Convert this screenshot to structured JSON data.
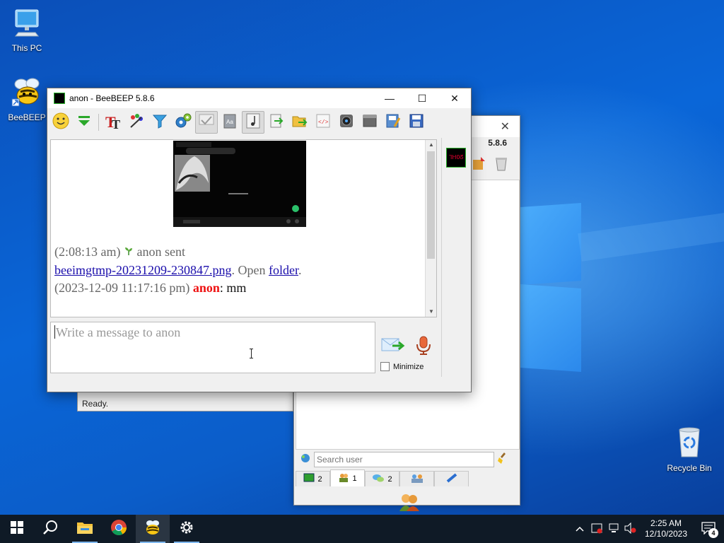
{
  "desktop": {
    "icons": [
      {
        "label": "This PC"
      },
      {
        "label": "BeeBEEP"
      },
      {
        "label": "Recycle Bin"
      }
    ]
  },
  "chat_window": {
    "title": "anon - BeeBEEP 5.8.6",
    "controls": {
      "minimize": "—",
      "maximize": "☐",
      "close": "✕"
    },
    "messages": {
      "line1_time": "(2:08:13 am)",
      "line1_text": " anon sent",
      "file_link": "beeimgtmp-20231209-230847.png",
      "open_text": ". Open ",
      "folder_link": "folder",
      "period": ".",
      "line3_time": "(2023-12-09 11:17:16 pm) ",
      "line3_sender": "anon",
      "line3_sep": ": ",
      "line3_msg": "mm"
    },
    "compose_placeholder": "Write a message to anon",
    "minimize_label": "Minimize",
    "side_avatar_text": "ᒣᕼOᘔ"
  },
  "main_window": {
    "version": "5.8.6",
    "search_placeholder": "Search user",
    "tabs": [
      {
        "count": "2"
      },
      {
        "count": "1"
      },
      {
        "count": "2"
      },
      {
        "count": ""
      },
      {
        "count": ""
      }
    ]
  },
  "ready_window": {
    "status": "Ready."
  },
  "taskbar": {
    "clock_time": "2:25 AM",
    "clock_date": "12/10/2023",
    "notification_count": "4"
  }
}
